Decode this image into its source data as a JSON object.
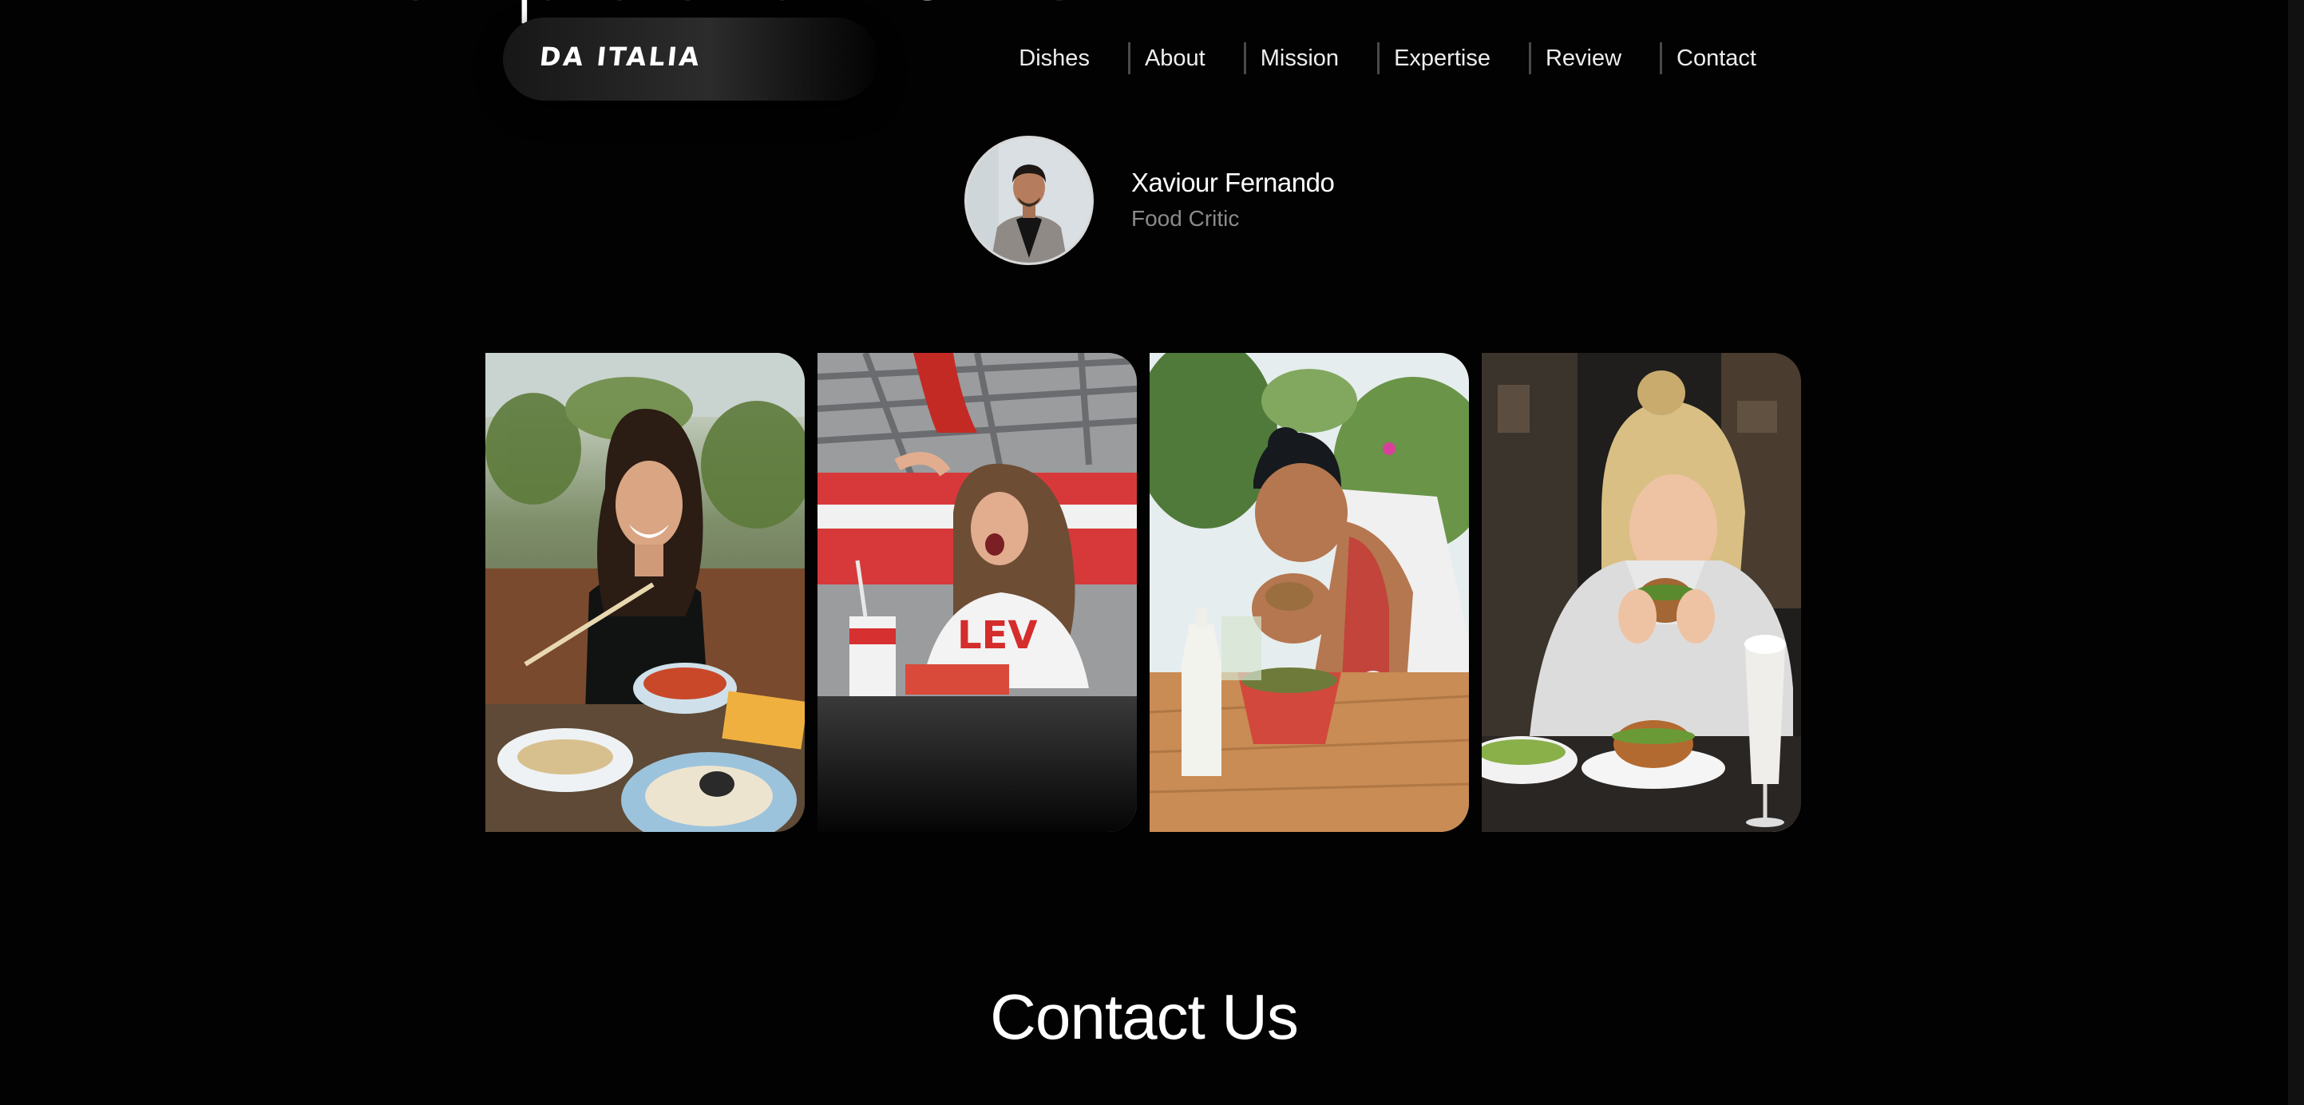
{
  "hero": {
    "fragment": "expectations"
  },
  "header": {
    "brand": "DA ITALIA",
    "nav": [
      {
        "label": "Dishes"
      },
      {
        "label": "About"
      },
      {
        "label": "Mission"
      },
      {
        "label": "Expertise"
      },
      {
        "label": "Review"
      },
      {
        "label": "Contact"
      }
    ]
  },
  "critic": {
    "name": "Xaviour Fernando",
    "role": "Food Critic"
  },
  "gallery": {
    "photos": [
      {
        "subject": "woman-eating-dumplings-photo"
      },
      {
        "subject": "woman-eating-fries-photo"
      },
      {
        "subject": "woman-eating-wrap-photo"
      },
      {
        "subject": "woman-eating-burger-photo"
      }
    ]
  },
  "contact": {
    "heading": "Contact Us"
  },
  "colors": {
    "background": "#020202",
    "text": "#f2f2f2",
    "muted": "#8a8a8a",
    "separator": "#4a4a4a"
  }
}
